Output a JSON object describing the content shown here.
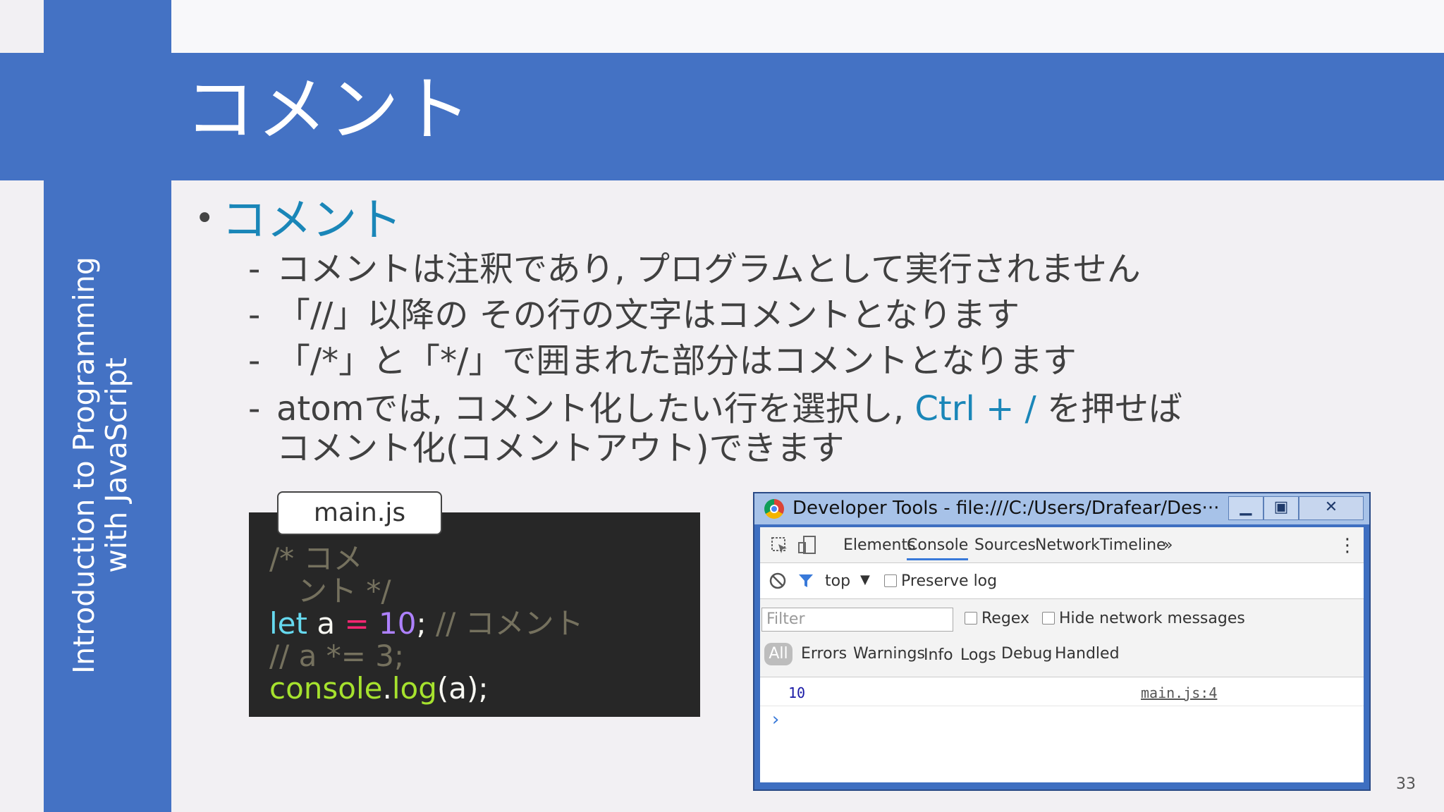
{
  "slide": {
    "title": "コメント",
    "side_label_line1": "Introduction to Programming",
    "side_label_line2": "with JavaScript",
    "page_number": "33",
    "bullet": "コメント",
    "items": [
      "コメントは注釈であり, プログラムとして実行されません",
      "「//」以降の その行の文字はコメントとなります",
      "「/*」と「*/」で囲まれた部分はコメントとなります"
    ],
    "item4_part1": "atomでは, コメント化したい行を選択し, ",
    "item4_shortcut": "Ctrl + /",
    "item4_part2": " を押せば",
    "item4_line2": "コメント化(コメントアウト)できます",
    "dash": "-"
  },
  "code_panel": {
    "filename": "main.js",
    "line1": "/* コメ",
    "line2": "   ント */",
    "line3_kw": "let",
    "line3_var": " a ",
    "line3_op": "=",
    "line3_num": " 10",
    "line3_semi": ";",
    "line3_comment": " // コメント",
    "line4": "// a *= 3;",
    "line5_fn": "console",
    "line5_dot": ".",
    "line5_call": "log",
    "line5_args": "(a);"
  },
  "devtools": {
    "window_title": "Developer Tools - file:///C:/Users/Drafear/Des···",
    "tabs": [
      "Elements",
      "Console",
      "Sources",
      "Network",
      "Timeline"
    ],
    "more_tabs": "»",
    "context": "top",
    "preserve_log": "Preserve log",
    "filter_placeholder": "Filter",
    "regex": "Regex",
    "hide_network": "Hide network messages",
    "levels": [
      "All",
      "Errors",
      "Warnings",
      "Info",
      "Logs",
      "Debug",
      "Handled"
    ],
    "log_value": "10",
    "log_source": "main.js:4",
    "prompt": "›"
  },
  "colors": {
    "brand_blue": "#4472c4",
    "accent_teal": "#1a86b8",
    "code_bg": "#272727"
  }
}
